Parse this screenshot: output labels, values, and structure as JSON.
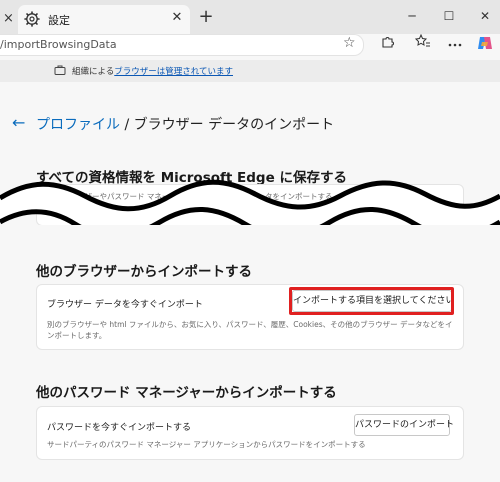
{
  "tab": {
    "prev_close": "×",
    "title": "設定",
    "close": "✕",
    "new_tab": "+"
  },
  "window": {
    "minimize": "─",
    "maximize": "☐",
    "close": "✕"
  },
  "address": {
    "url": "/importBrowsingData",
    "star": "☆"
  },
  "banner": {
    "prefix": "組織による",
    "link": "ブラウザーは管理されています"
  },
  "breadcrumb": {
    "back": "←",
    "parent": "プロファイル",
    "separator": " / ",
    "current": "ブラウザー データのインポート"
  },
  "section_edge": {
    "heading": "すべての資格情報を Microsoft Edge に保存する",
    "description": "他のブラウザーやパスワード マネージャーから",
    "description_tail": "タをインポートする"
  },
  "section_browsers": {
    "heading": "他のブラウザーからインポートする",
    "card_title": "ブラウザー データを今すぐインポート",
    "card_desc": "別のブラウザーや html ファイルから、お気に入り、パスワード、履歴、Cookies、その他のブラウザー データなどをインポートします。",
    "button": "インポートする項目を選択してください"
  },
  "section_passwords": {
    "heading": "他のパスワード マネージャーからインポートする",
    "card_title": "パスワードを今すぐインポートする",
    "card_desc": "サードパーティのパスワード マネージャー アプリケーションからパスワードをインポートする",
    "button": "パスワードのインポート"
  }
}
